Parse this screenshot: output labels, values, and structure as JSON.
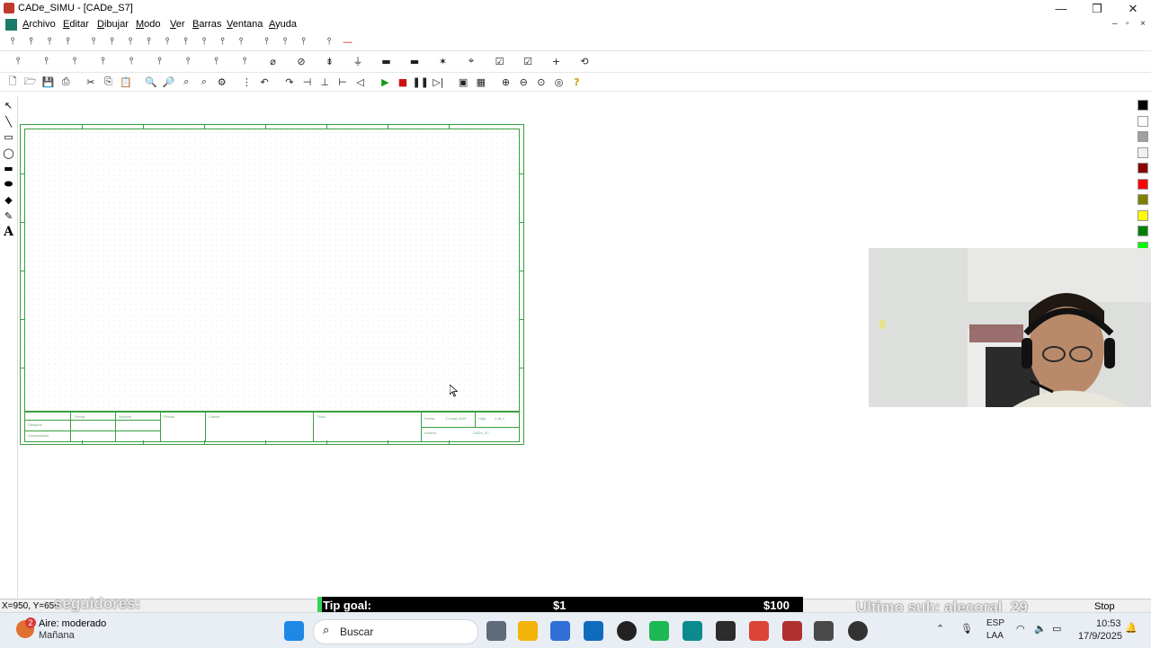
{
  "window": {
    "title": "CADe_SIMU - [CADe_S7]",
    "minimize_glyph": "—",
    "maximize_glyph": "❐",
    "close_glyph": "✕",
    "mdi_min": "–",
    "mdi_restore": "▫",
    "mdi_close": "×"
  },
  "menu": [
    "Archivo",
    "Editar",
    "Dibujar",
    "Modo",
    "Ver",
    "Barras",
    "Ventana",
    "Ayuda"
  ],
  "toolbar1_icons": [
    "contact-no-icon",
    "contact-nc-icon",
    "switch-icon",
    "switch-3p-icon",
    "fuse-icon",
    "fuse-block-icon",
    "breaker-icon",
    "breaker-3p-icon",
    "junction-icon",
    "terminal-icon",
    "relay-icon",
    "motor-protector-icon",
    "contactor-icon",
    "contactor-3p-icon",
    "thermal-relay-icon",
    "meter-icon",
    "lamp-block-icon",
    "wire-red-icon"
  ],
  "toolbar2_icons": [
    "push-no-icon",
    "push-nc-icon",
    "push-nonc-icon",
    "selector-icon",
    "selector-3p-icon",
    "limit-switch-icon",
    "limit-switch-3p-icon",
    "sensor-icon",
    "sensor-3p-icon",
    "timer-icon",
    "timer-off-icon",
    "coil-icon",
    "ground-icon",
    "busbar-icon",
    "busbar-2-icon",
    "junction-star-icon",
    "crosshair-icon",
    "check-box-icon",
    "check-box-2-icon",
    "cross-icon",
    "rotate-icon"
  ],
  "toolbar3_icons": [
    "new-icon",
    "open-icon",
    "save-icon",
    "print-icon",
    "cut-icon",
    "copy-icon",
    "paste-icon",
    "find-icon",
    "find-next-icon",
    "zoom-sel-icon",
    "print-preview-icon",
    "properties-icon",
    "grid-icon",
    "undo-icon",
    "redo-icon",
    "align-left-icon",
    "align-center-icon",
    "align-right-icon",
    "arrow-left-icon",
    "play-icon",
    "stop-icon",
    "pause-icon",
    "step-icon",
    "window-icon",
    "window-2-icon",
    "zoom-in-icon",
    "zoom-out-icon",
    "zoom-fit-icon",
    "zoom-all-icon",
    "help-icon"
  ],
  "left_palette_icons": [
    "pointer-icon",
    "line-icon",
    "rectangle-icon",
    "ellipse-icon",
    "filled-rectangle-icon",
    "filled-ellipse-icon",
    "fill-icon",
    "pencil-icon",
    "text-icon"
  ],
  "left_palette_text_glyph": "A",
  "colors": [
    "#000000",
    "#ffffff",
    "#a0a0a0",
    "#f0f0f0",
    "#8b0000",
    "#ff0000",
    "#808000",
    "#ffff00",
    "#008000",
    "#00ff00"
  ],
  "titleblock": {
    "fecha": "Fecha",
    "nombre": "Nombre",
    "firmas": "Firmas",
    "cliente": "Cliente",
    "titulo": "Título",
    "dibujado": "Dibujado",
    "comprobado": "Comprobado",
    "fecha_label": "Fecha",
    "fecha_value": "17-sept-2025",
    "hoja": "Hoja",
    "hoja_value": "1 de 1",
    "archivo": "Archivo",
    "archivo_value": "CADe_S7"
  },
  "status": {
    "coords": "X=950, Y=656",
    "followers_overlay": "seguidores:",
    "page_indicator": "Stop"
  },
  "tipgoal": {
    "label": "Tip goal:",
    "current": "$1",
    "target": "$100",
    "progress_fraction": 0.01
  },
  "last_sub_overlay": "Ultimo sub: alecoral_29",
  "taskbar": {
    "weather_title": "Aire: moderado",
    "weather_sub": "Mañana",
    "weather_badge": "2",
    "search_placeholder": "Buscar",
    "language_top": "ESP",
    "language_bottom": "LAA",
    "time": "10:53",
    "date": "17/9/2025",
    "apps": [
      "windows-start-icon",
      "task-view-icon",
      "file-explorer-icon",
      "store-icon",
      "outlook-icon",
      "chatgpt-icon",
      "spotify-icon",
      "edge-icon",
      "editor-icon",
      "chrome-icon",
      "cade-simu-icon",
      "keyboard-app-icon",
      "obs-icon"
    ]
  }
}
